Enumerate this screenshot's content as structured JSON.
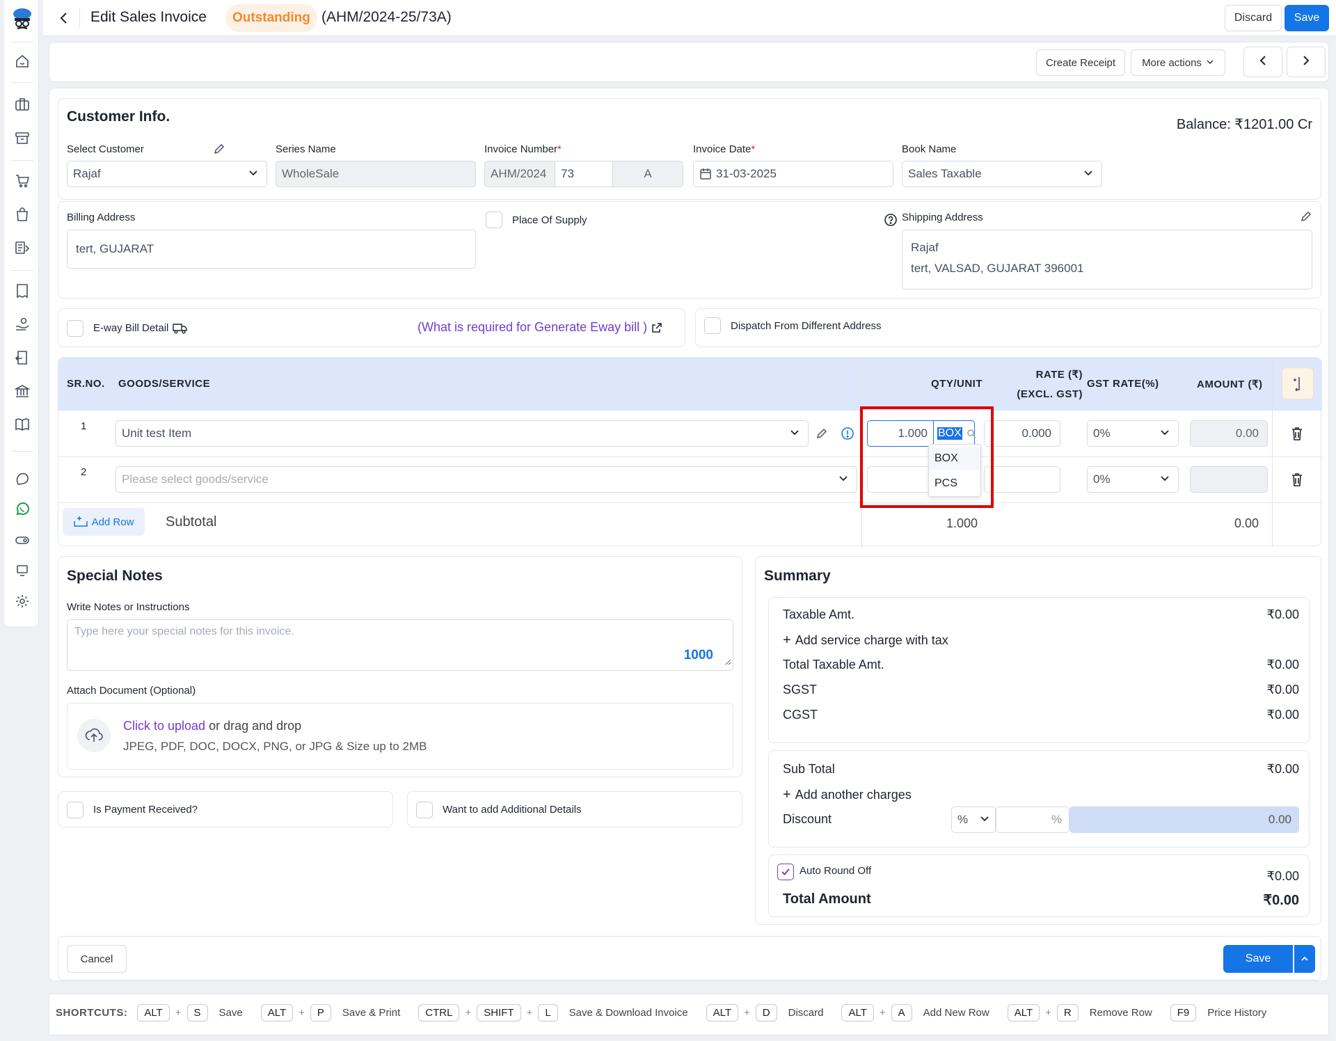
{
  "header": {
    "title": "Edit Sales Invoice",
    "status": "Outstanding",
    "invoice_ref": "(AHM/2024-25/73A)",
    "discard": "Discard",
    "save": "Save"
  },
  "actions": {
    "create_receipt": "Create Receipt",
    "more_actions": "More actions"
  },
  "customer": {
    "section_title": "Customer Info.",
    "balance": "Balance: ₹1201.00 Cr",
    "select_customer_label": "Select Customer",
    "customer_value": "Rajaf",
    "series_label": "Series Name",
    "series_value": "WholeSale",
    "invoice_number_label": "Invoice Number",
    "inv_prefix": "AHM/2024",
    "inv_num": "73",
    "inv_suffix": "A",
    "invoice_date_label": "Invoice Date",
    "invoice_date": "31-03-2025",
    "book_label": "Book Name",
    "book_value": "Sales Taxable",
    "required_mark": "*"
  },
  "address": {
    "billing_label": "Billing Address",
    "billing_value": "tert, GUJARAT",
    "place_of_supply": "Place Of Supply",
    "shipping_label": "Shipping Address",
    "shipping_name": "Rajaf",
    "shipping_value": "tert, VALSAD, GUJARAT 396001"
  },
  "eway": {
    "label": "E-way Bill Detail",
    "link": "(What is required for Generate Eway bill )",
    "dispatch": "Dispatch From Different Address"
  },
  "table": {
    "headers": {
      "sr": "SR.NO.",
      "goods": "GOODS/SERVICE",
      "qty": "QTY/UNIT",
      "rate1": "RATE (₹)",
      "rate2": "(EXCL. GST)",
      "gst": "GST RATE(%)",
      "amount": "AMOUNT (₹)"
    },
    "rows": [
      {
        "sr": "1",
        "item": "Unit test Item",
        "qty": "1.000",
        "unit": "BOX",
        "rate": "0.000",
        "gst": "0%",
        "amount": "0.00"
      },
      {
        "sr": "2",
        "item_placeholder": "Please select goods/service",
        "gst": "0%"
      }
    ],
    "unit_options": [
      "BOX",
      "PCS"
    ],
    "add_row": "Add Row",
    "subtotal_label": "Subtotal",
    "subtotal_qty": "1.000",
    "subtotal_amount": "0.00"
  },
  "notes": {
    "title": "Special Notes",
    "label": "Write Notes or Instructions",
    "placeholder": "Type here your special notes for this invoice.",
    "counter": "1000",
    "attach_label": "Attach Document (Optional)",
    "upload_link": "Click to upload",
    "upload_rest": " or drag and drop",
    "upload_hint": "JPEG, PDF, DOC, DOCX, PNG, or JPG & Size up to 2MB"
  },
  "options": {
    "payment": "Is Payment Received?",
    "additional": "Want to add Additional Details"
  },
  "summary": {
    "title": "Summary",
    "taxable": "Taxable Amt.",
    "taxable_val": "₹0.00",
    "add_service": "Add service charge with tax",
    "total_taxable": "Total Taxable Amt.",
    "total_taxable_val": "₹0.00",
    "sgst": "SGST",
    "sgst_val": "₹0.00",
    "cgst": "CGST",
    "cgst_val": "₹0.00",
    "sub_total": "Sub Total",
    "sub_total_val": "₹0.00",
    "add_charges": "Add another charges",
    "discount": "Discount",
    "discount_type": "%",
    "discount_pct": "%",
    "discount_val": "0.00",
    "round_off": "Auto Round Off",
    "round_off_val": "₹0.00",
    "total": "Total Amount",
    "total_val": "₹0.00"
  },
  "footer": {
    "cancel": "Cancel",
    "save": "Save"
  },
  "shortcuts": {
    "label": "SHORTCUTS:",
    "items": [
      {
        "keys": [
          "ALT",
          "S"
        ],
        "action": "Save"
      },
      {
        "keys": [
          "ALT",
          "P"
        ],
        "action": "Save & Print"
      },
      {
        "keys": [
          "CTRL",
          "SHIFT",
          "L"
        ],
        "action": "Save & Download Invoice"
      },
      {
        "keys": [
          "ALT",
          "D"
        ],
        "action": "Discard"
      },
      {
        "keys": [
          "ALT",
          "A"
        ],
        "action": "Add New Row"
      },
      {
        "keys": [
          "ALT",
          "R"
        ],
        "action": "Remove Row"
      },
      {
        "keys": [
          "F9"
        ],
        "action": "Price History"
      }
    ]
  },
  "colors": {
    "primary": "#1575e6",
    "link": "#6e3fd1",
    "badge": "#f28a2e",
    "highlight": "#e00000"
  }
}
